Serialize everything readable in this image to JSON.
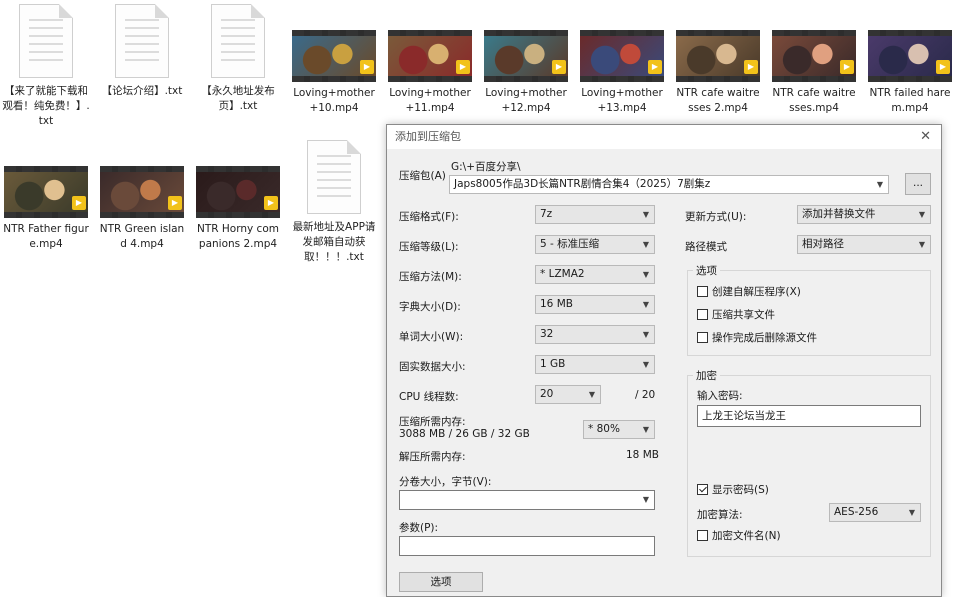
{
  "files": [
    {
      "name": "【来了就能下载和观看！纯免费！】.txt",
      "type": "txt"
    },
    {
      "name": "【论坛介绍】.txt",
      "type": "txt"
    },
    {
      "name": "【永久地址发布页】.txt",
      "type": "txt"
    },
    {
      "name": "Loving+mother+10.mp4",
      "type": "video",
      "palette": [
        "#3a6a8a",
        "#c9a040",
        "#6a4a2a"
      ]
    },
    {
      "name": "Loving+mother+11.mp4",
      "type": "video",
      "palette": [
        "#7a5a3a",
        "#d8b070",
        "#8a2a2a"
      ]
    },
    {
      "name": "Loving+mother+12.mp4",
      "type": "video",
      "palette": [
        "#3a7a8a",
        "#c9b080",
        "#5a3a2a"
      ]
    },
    {
      "name": "Loving+mother+13.mp4",
      "type": "video",
      "palette": [
        "#6a2a2a",
        "#c04a3a",
        "#3a4a7a"
      ]
    },
    {
      "name": "NTR cafe waitresses 2.mp4",
      "type": "video",
      "palette": [
        "#8a6a4a",
        "#d8b890",
        "#4a3a2a"
      ]
    },
    {
      "name": "NTR cafe waitresses.mp4",
      "type": "video",
      "palette": [
        "#7a4a3a",
        "#e0a080",
        "#3a2a2a"
      ]
    },
    {
      "name": "NTR failed harem.mp4",
      "type": "video",
      "palette": [
        "#4a3a6a",
        "#d8c0b0",
        "#2a2a4a"
      ]
    },
    {
      "name": "NTR Father figure.mp4",
      "type": "video",
      "palette": [
        "#6a5a3a",
        "#e0c090",
        "#3a3a2a"
      ]
    },
    {
      "name": "NTR Green island 4.mp4",
      "type": "video",
      "palette": [
        "#3a2a2a",
        "#c07a4a",
        "#6a4a3a"
      ]
    },
    {
      "name": "NTR Horny companions 2.mp4",
      "type": "video",
      "palette": [
        "#2a1a1a",
        "#5a2a2a",
        "#3a2a2a"
      ]
    },
    {
      "name": "最新地址及APP请发邮箱自动获取！！！.txt",
      "type": "txt"
    }
  ],
  "dialog": {
    "title": "添加到压缩包",
    "close_glyph": "✕",
    "archive_label": "压缩包(A)",
    "archive_dir": "G:\\+百度分享\\",
    "archive_value": "Japs8005作品3D长篇NTR剧情合集4（2025）7剧集z",
    "browse_label": "...",
    "format_label": "压缩格式(F):",
    "format_value": "7z",
    "level_label": "压缩等级(L):",
    "level_value": "5 - 标准压缩",
    "method_label": "压缩方法(M):",
    "method_value": "* LZMA2",
    "dict_label": "字典大小(D):",
    "dict_value": "16 MB",
    "word_label": "单词大小(W):",
    "word_value": "32",
    "solid_label": "固实数据大小:",
    "solid_value": "1 GB",
    "threads_label": "CPU 线程数:",
    "threads_value": "20",
    "threads_total": "/ 20",
    "mem_label": "压缩所需内存:",
    "mem_detail": "3088 MB / 26 GB / 32 GB",
    "mem_value": "* 80%",
    "decomp_label": "解压所需内存:",
    "decomp_value": "18 MB",
    "volume_label": "分卷大小，字节(V):",
    "params_label": "参数(P):",
    "options_button": "选项",
    "update_label": "更新方式(U):",
    "update_value": "添加并替换文件",
    "path_label": "路径模式",
    "path_value": "相对路径",
    "options_group": "选项",
    "opt_sfx": "创建自解压程序(X)",
    "opt_shared": "压缩共享文件",
    "opt_delete": "操作完成后删除源文件",
    "encrypt_group": "加密",
    "password_label": "输入密码:",
    "password_value": "上龙王论坛当龙王",
    "show_password": "显示密码(S)",
    "enc_method_label": "加密算法:",
    "enc_method_value": "AES-256",
    "encrypt_names": "加密文件名(N)"
  }
}
